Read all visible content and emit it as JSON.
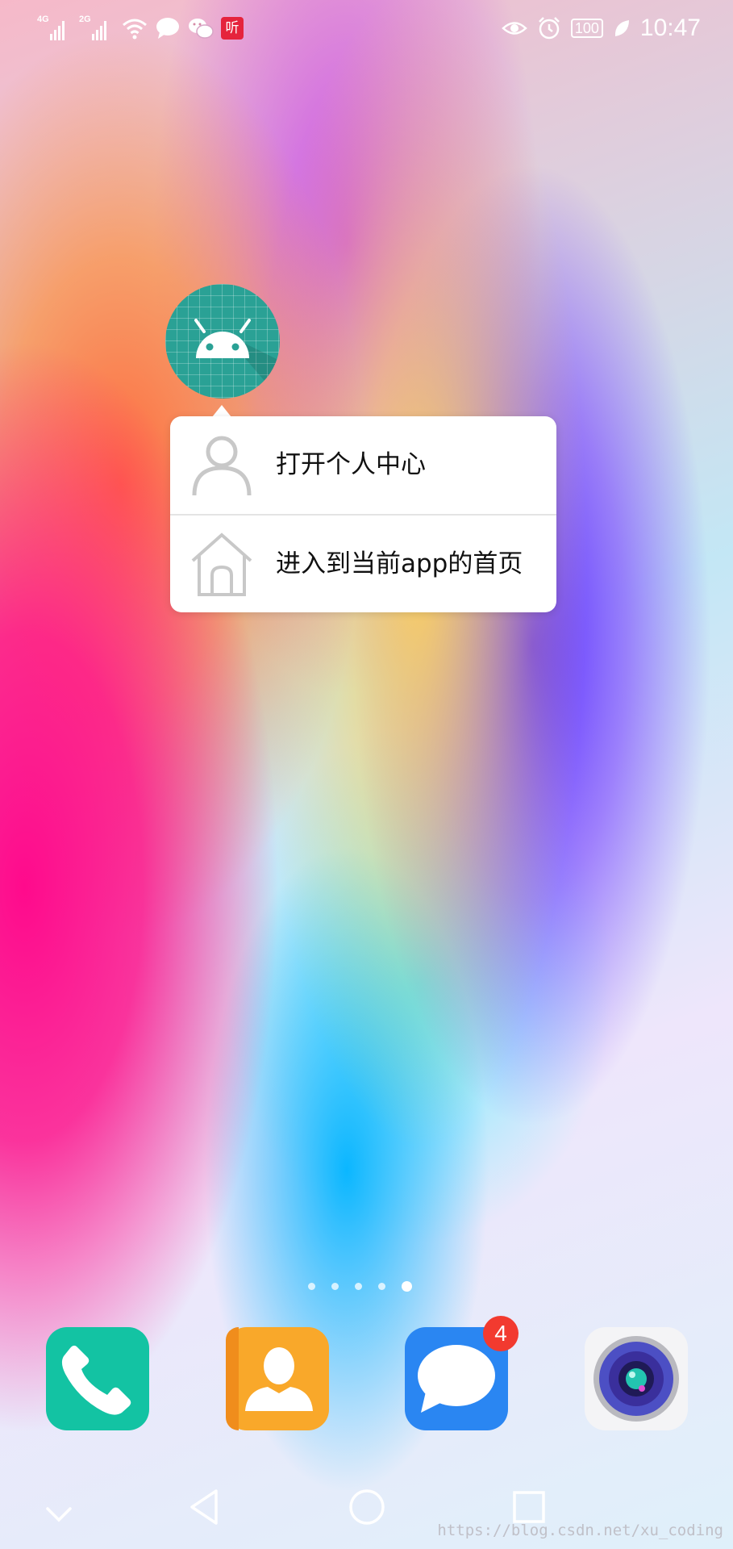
{
  "status_bar": {
    "signal1_label": "4G",
    "signal2_label": "2G",
    "ting_label": "听",
    "battery": "100",
    "time": "10:47"
  },
  "shortcut_menu": {
    "items": [
      {
        "label": "打开个人中心",
        "icon": "person-icon"
      },
      {
        "label": "进入到当前app的首页",
        "icon": "home-icon"
      }
    ]
  },
  "home_pages": {
    "count": 5,
    "active_index": 4
  },
  "dock": {
    "apps": [
      {
        "name": "phone",
        "color": "#13c3a3"
      },
      {
        "name": "contacts",
        "color": "#f9a82a"
      },
      {
        "name": "messages",
        "color": "#2a86f2",
        "badge": "4"
      },
      {
        "name": "camera",
        "color": "#f4f4f6"
      }
    ]
  },
  "watermark": "https://blog.csdn.net/xu_coding"
}
